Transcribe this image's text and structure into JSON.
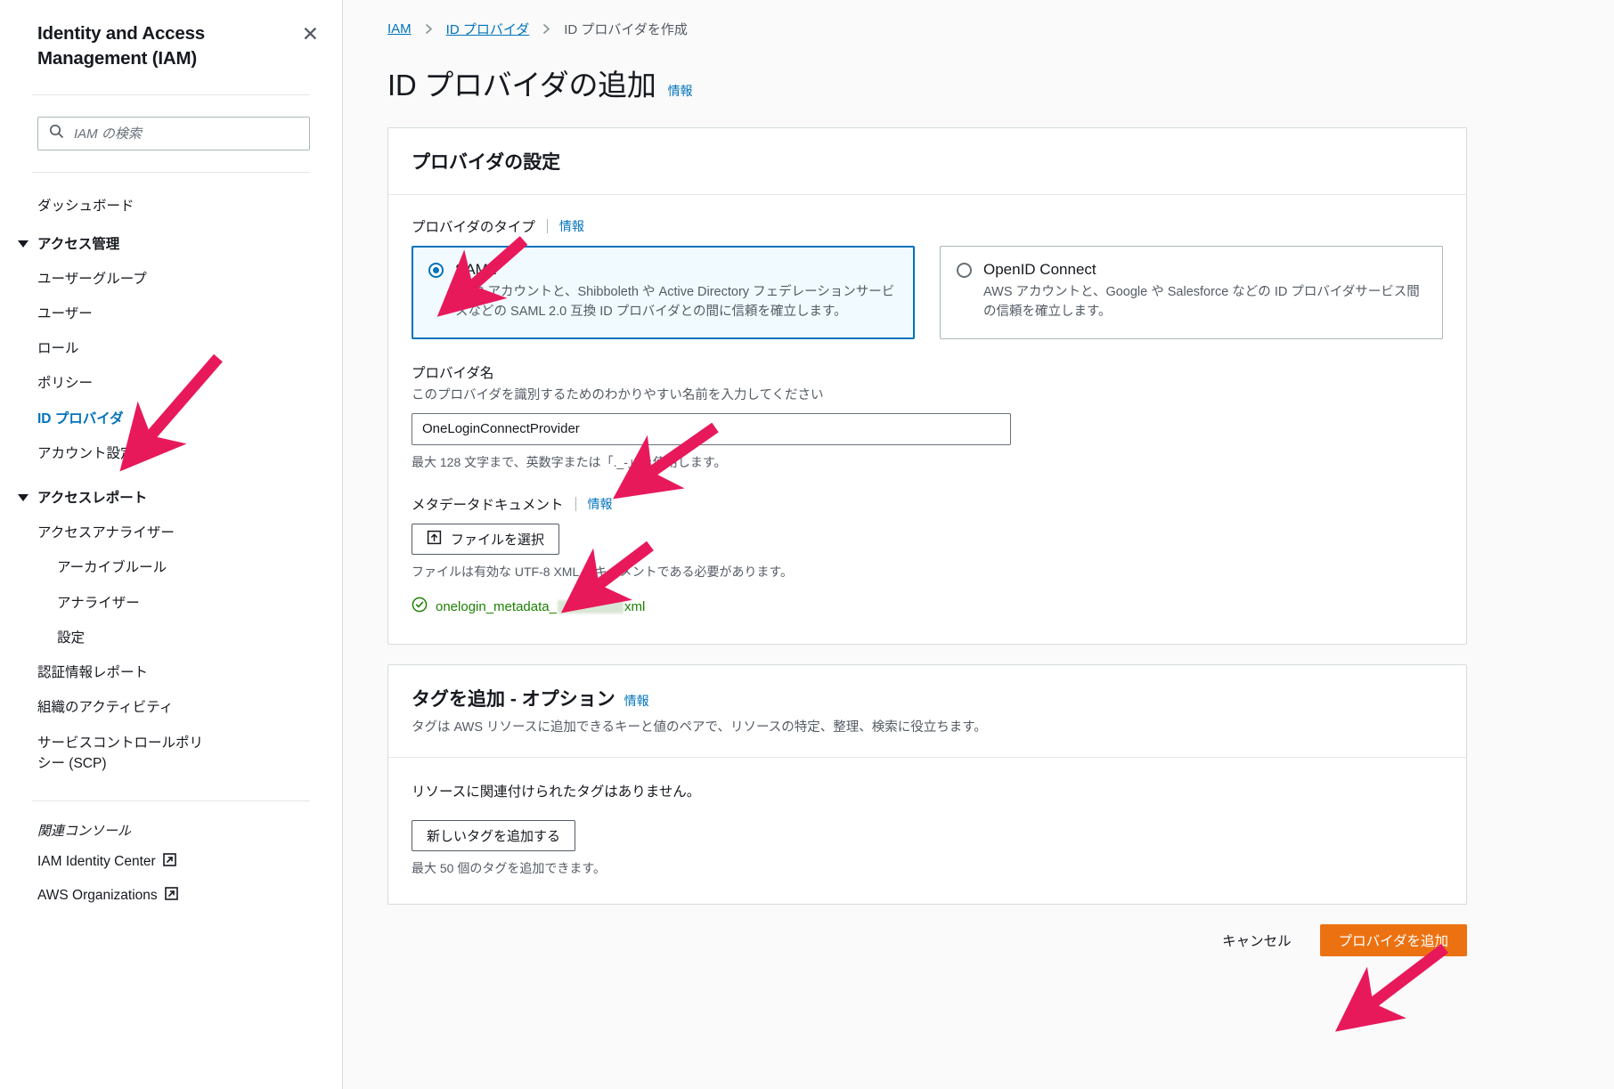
{
  "sidebar": {
    "title": "Identity and Access Management (IAM)",
    "close_icon": "close-icon",
    "search": {
      "placeholder": "IAM の検索",
      "icon": "search-icon",
      "value": ""
    },
    "dashboard": "ダッシュボード",
    "groups": [
      {
        "label": "アクセス管理",
        "items": [
          {
            "label": "ユーザーグループ",
            "selected": false
          },
          {
            "label": "ユーザー",
            "selected": false
          },
          {
            "label": "ロール",
            "selected": false
          },
          {
            "label": "ポリシー",
            "selected": false
          },
          {
            "label": "ID プロバイダ",
            "selected": true
          },
          {
            "label": "アカウント設定",
            "selected": false
          }
        ]
      },
      {
        "label": "アクセスレポート",
        "items": [
          {
            "label": "アクセスアナライザー",
            "indent": 0
          },
          {
            "label": "アーカイブルール",
            "indent": 1
          },
          {
            "label": "アナライザー",
            "indent": 1
          },
          {
            "label": "設定",
            "indent": 1
          },
          {
            "label": "認証情報レポート",
            "indent": 0
          },
          {
            "label": "組織のアクティビティ",
            "indent": 0
          },
          {
            "label": "サービスコントロールポリシー (SCP)",
            "indent": 0
          }
        ]
      }
    ],
    "related_title": "関連コンソール",
    "related": [
      {
        "label": "IAM Identity Center",
        "icon": "external-link-icon"
      },
      {
        "label": "AWS Organizations",
        "icon": "external-link-icon"
      }
    ]
  },
  "breadcrumb": [
    {
      "label": "IAM",
      "link": true
    },
    {
      "label": "ID プロバイダ",
      "link": true
    },
    {
      "label": "ID プロバイダを作成",
      "link": false
    }
  ],
  "page": {
    "title": "ID プロバイダの追加",
    "info_label": "情報"
  },
  "provider_card": {
    "title": "プロバイダの設定",
    "type_label": "プロバイダのタイプ",
    "type_info": "情報",
    "options": [
      {
        "value": "SAML",
        "label": "SAML",
        "selected": true,
        "description": "AWS アカウントと、Shibboleth や Active Directory フェデレーションサービスなどの SAML 2.0 互換 ID プロバイダとの間に信頼を確立します。"
      },
      {
        "value": "OIDC",
        "label": "OpenID Connect",
        "selected": false,
        "description": "AWS アカウントと、Google や Salesforce などの ID プロバイダサービス間の信頼を確立します。"
      }
    ],
    "name_label": "プロバイダ名",
    "name_hint": "このプロバイダを識別するためのわかりやすい名前を入力してください",
    "name_value": "OneLoginConnectProvider",
    "name_note": "最大 128 文字まで、英数字または「._-」を使用します。",
    "metadata_label": "メタデータドキュメント",
    "metadata_info": "情報",
    "choose_file_button": "ファイルを選択",
    "choose_file_icon": "upload-icon",
    "metadata_note": "ファイルは有効な UTF-8 XML ドキュメントである必要があります。",
    "uploaded_file_prefix": "onelogin_metadata_",
    "uploaded_file_suffix": "xml",
    "uploaded_file_icon": "check-circle-icon"
  },
  "tags_card": {
    "title": "タグを追加 - オプション",
    "info_label": "情報",
    "description": "タグは AWS リソースに追加できるキーと値のペアで、リソースの特定、整理、検索に役立ちます。",
    "empty_text": "リソースに関連付けられたタグはありません。",
    "add_tag_button": "新しいタグを追加する",
    "limit_note": "最大 50 個のタグを追加できます。"
  },
  "footer": {
    "cancel": "キャンセル",
    "submit": "プロバイダを追加"
  },
  "annotations": {
    "color": "#e8195b",
    "arrows": [
      {
        "name": "arrow-to-id-provider-nav"
      },
      {
        "name": "arrow-to-saml-radio"
      },
      {
        "name": "arrow-to-provider-name-input"
      },
      {
        "name": "arrow-to-choose-file-button"
      },
      {
        "name": "arrow-to-add-provider-button"
      }
    ]
  }
}
